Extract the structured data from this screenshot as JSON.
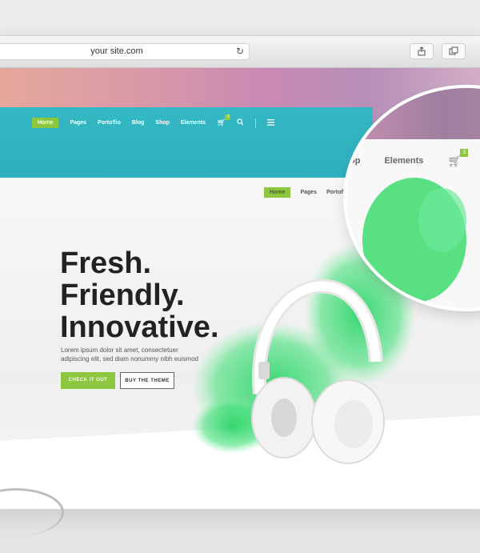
{
  "browser": {
    "url": "your site.com",
    "reload_icon": "reload-icon",
    "share_icon": "share-icon",
    "tabs_icon": "tabs-icon"
  },
  "teal_nav": {
    "items": [
      "Home",
      "Pages",
      "Portoflio",
      "Blog",
      "Shop",
      "Elements"
    ],
    "cart_count": "3"
  },
  "white_nav": {
    "items": [
      "Home",
      "Pages",
      "Portoflio"
    ]
  },
  "magnifier": {
    "item_left": "op",
    "item_elements": "Elements",
    "cart_count": "3"
  },
  "hero": {
    "headline_1": "Fresh.",
    "headline_2": "Friendly.",
    "headline_3": "Innovative.",
    "body": "Lorem ipsum dolor sit amet, consectetuer adipiscing elit, sed diam nonummy nibh euismod",
    "primary_button": "CHECK IT OUT",
    "secondary_button": "BUY THE THEME"
  },
  "colors": {
    "accent_green": "#8dc63f",
    "teal": "#34b8c4",
    "splash_green": "#3ddc6f"
  }
}
